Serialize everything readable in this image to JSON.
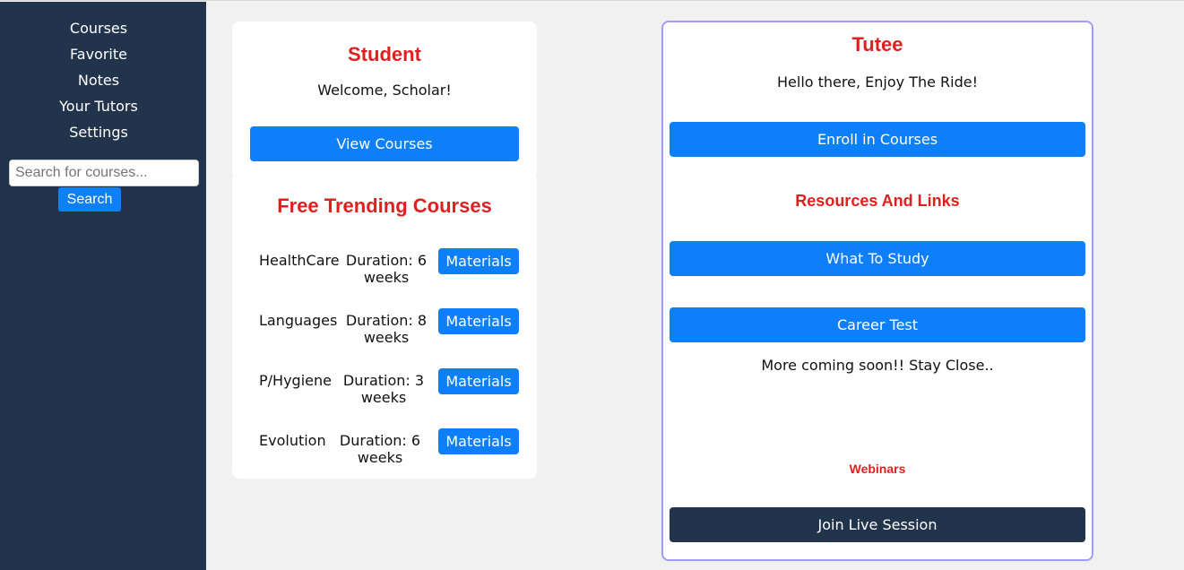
{
  "sidebar": {
    "nav": [
      "Courses",
      "Favorite",
      "Notes",
      "Your Tutors",
      "Settings"
    ],
    "search_placeholder": "Search for courses...",
    "search_button": "Search"
  },
  "student": {
    "title": "Student",
    "welcome": "Welcome, Scholar!",
    "view_courses": "View Courses"
  },
  "trending": {
    "title": "Free Trending Courses",
    "courses": [
      {
        "name": "HealthCare",
        "duration": "Duration: 6 weeks",
        "button": "Materials"
      },
      {
        "name": "Languages",
        "duration": "Duration: 8 weeks",
        "button": "Materials"
      },
      {
        "name": "P/Hygiene",
        "duration": "Duration: 3 weeks",
        "button": "Materials"
      },
      {
        "name": "Evolution",
        "duration": "Duration: 6 weeks",
        "button": "Materials"
      }
    ]
  },
  "tutee": {
    "title": "Tutee",
    "greeting": "Hello there, Enjoy The Ride!",
    "enroll": "Enroll in Courses",
    "resources_heading": "Resources And Links",
    "what_to_study": "What To Study",
    "career_test": "Career Test",
    "coming_soon": "More coming soon!! Stay Close..",
    "webinars_heading": "Webinars",
    "join_live": "Join Live Session"
  },
  "colors": {
    "sidebar_bg": "#22344c",
    "accent_blue": "#0d7ff8",
    "heading_red": "#e02020",
    "tutee_border": "#a29cf4"
  }
}
